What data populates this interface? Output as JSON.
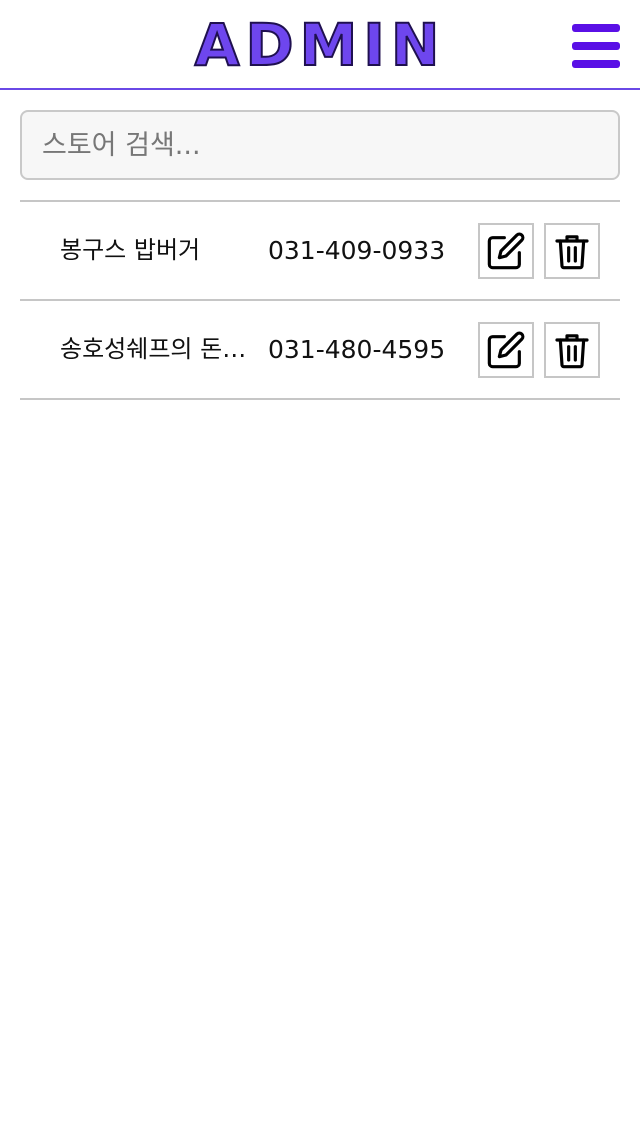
{
  "header": {
    "logo": "ADMIN",
    "menu_icon": "hamburger-menu-icon",
    "accent_color": "#6e46ee"
  },
  "search": {
    "placeholder": "스토어 검색...",
    "value": ""
  },
  "stores": [
    {
      "name": "봉구스 밥버거",
      "phone": "031-409-0933",
      "edit_icon": "edit-icon",
      "delete_icon": "trash-icon"
    },
    {
      "name": "송호성쉐프의 돈…",
      "phone": "031-480-4595",
      "edit_icon": "edit-icon",
      "delete_icon": "trash-icon"
    }
  ]
}
